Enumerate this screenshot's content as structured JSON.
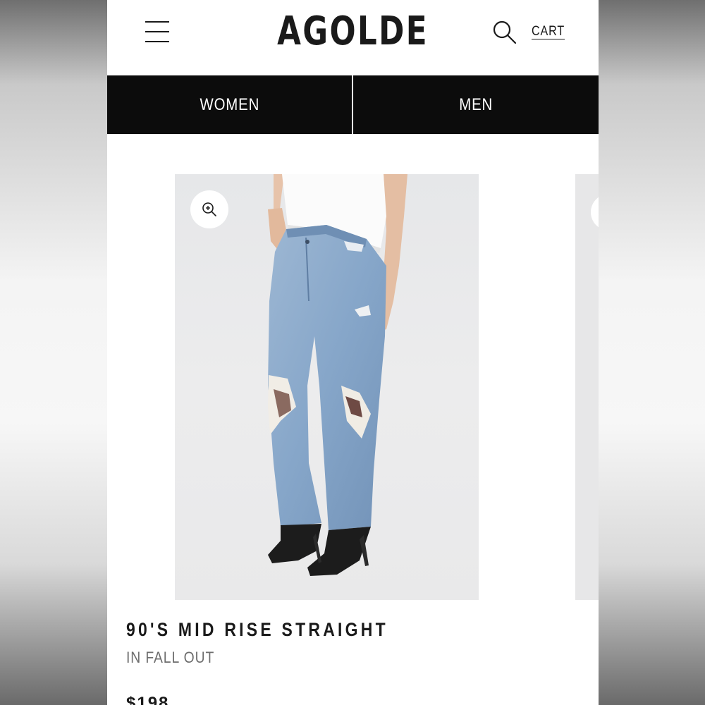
{
  "header": {
    "logo": "AGOLDE",
    "cart_label": "CART",
    "icons": {
      "menu": "hamburger-icon",
      "search": "search-icon"
    }
  },
  "nav": {
    "tabs": [
      {
        "label": "WOMEN"
      },
      {
        "label": "MEN"
      }
    ]
  },
  "product": {
    "name": "90'S MID RISE STRAIGHT",
    "color_line": "IN FALL OUT",
    "price": "$198",
    "zoom_icon": "zoom-in-icon"
  }
}
